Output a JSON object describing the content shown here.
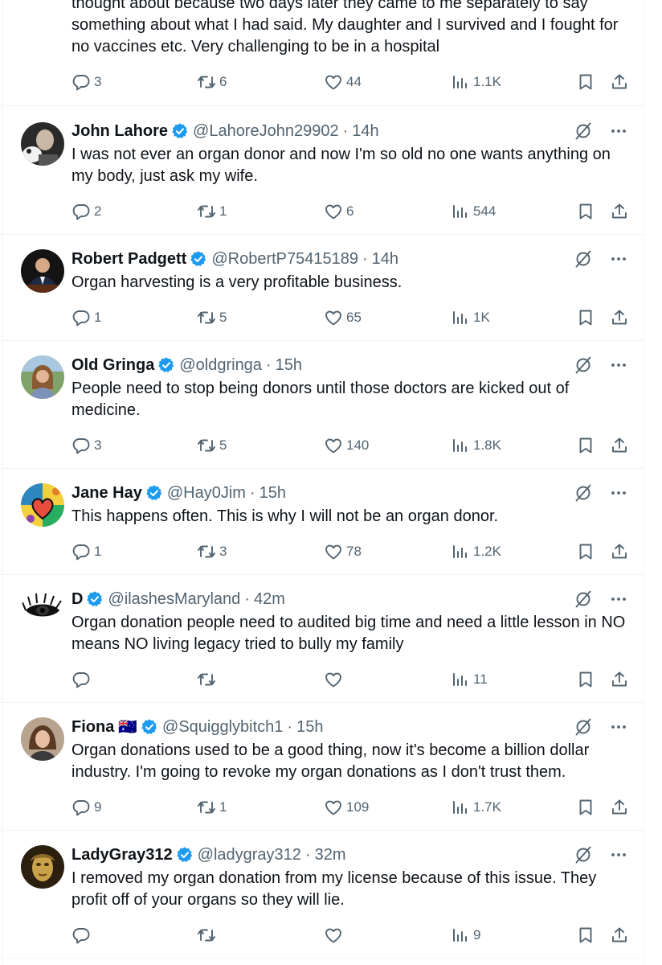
{
  "posts": [
    {
      "name": "",
      "handle": "",
      "time": "",
      "text": "thought about because two days later they came to me separately to say something about what I had said.    My daughter and I survived and I fought for no vaccines etc.  Very challenging to be in a hospital",
      "replies": "3",
      "reposts": "6",
      "likes": "44",
      "views": "1.1K"
    },
    {
      "name": "John Lahore",
      "handle": "@LahoreJohn29902",
      "time": "14h",
      "text": "I was not ever an organ donor and now I'm so old no one wants anything on my body, just ask my wife.",
      "replies": "2",
      "reposts": "1",
      "likes": "6",
      "views": "544"
    },
    {
      "name": "Robert Padgett",
      "handle": "@RobertP75415189",
      "time": "14h",
      "text": "Organ harvesting is a very profitable business.",
      "replies": "1",
      "reposts": "5",
      "likes": "65",
      "views": "1K"
    },
    {
      "name": "Old Gringa",
      "handle": "@oldgringa",
      "time": "15h",
      "text": "People need to stop being donors until those doctors are kicked out of medicine.",
      "replies": "3",
      "reposts": "5",
      "likes": "140",
      "views": "1.8K"
    },
    {
      "name": "Jane Hay",
      "handle": "@Hay0Jim",
      "time": "15h",
      "text": "This happens often. This is why I will not be an organ donor.",
      "replies": "1",
      "reposts": "3",
      "likes": "78",
      "views": "1.2K"
    },
    {
      "name": "D",
      "handle": "@ilashesMaryland",
      "time": "42m",
      "text": "Organ donation people need to audited big time and need a little lesson in NO means NO living legacy tried  to bully my family",
      "replies": "",
      "reposts": "",
      "likes": "",
      "views": "11"
    },
    {
      "name": "Fiona",
      "flag": "🇦🇺",
      "handle": "@Squigglybitch1",
      "time": "15h",
      "text": "Organ donations used to be a good thing, now it's become a billion dollar industry. I'm going to revoke my organ donations as I don't trust them.",
      "replies": "9",
      "reposts": "1",
      "likes": "109",
      "views": "1.7K"
    },
    {
      "name": "LadyGray312",
      "handle": "@ladygray312",
      "time": "32m",
      "text": "I removed my organ donation from my license because of this issue. They profit off of your organs so they will lie.",
      "replies": "",
      "reposts": "",
      "likes": "",
      "views": "9"
    }
  ],
  "ui": {
    "dot": "·",
    "icons": [
      "reply-icon",
      "repost-icon",
      "like-icon",
      "views-icon",
      "bookmark-icon",
      "share-icon",
      "grok-icon",
      "more-icon",
      "verified-badge-icon"
    ],
    "colors": {
      "text": "#0f1419",
      "muted": "#536471",
      "verified": "#1d9bf0",
      "divider": "#eff3f4"
    }
  }
}
